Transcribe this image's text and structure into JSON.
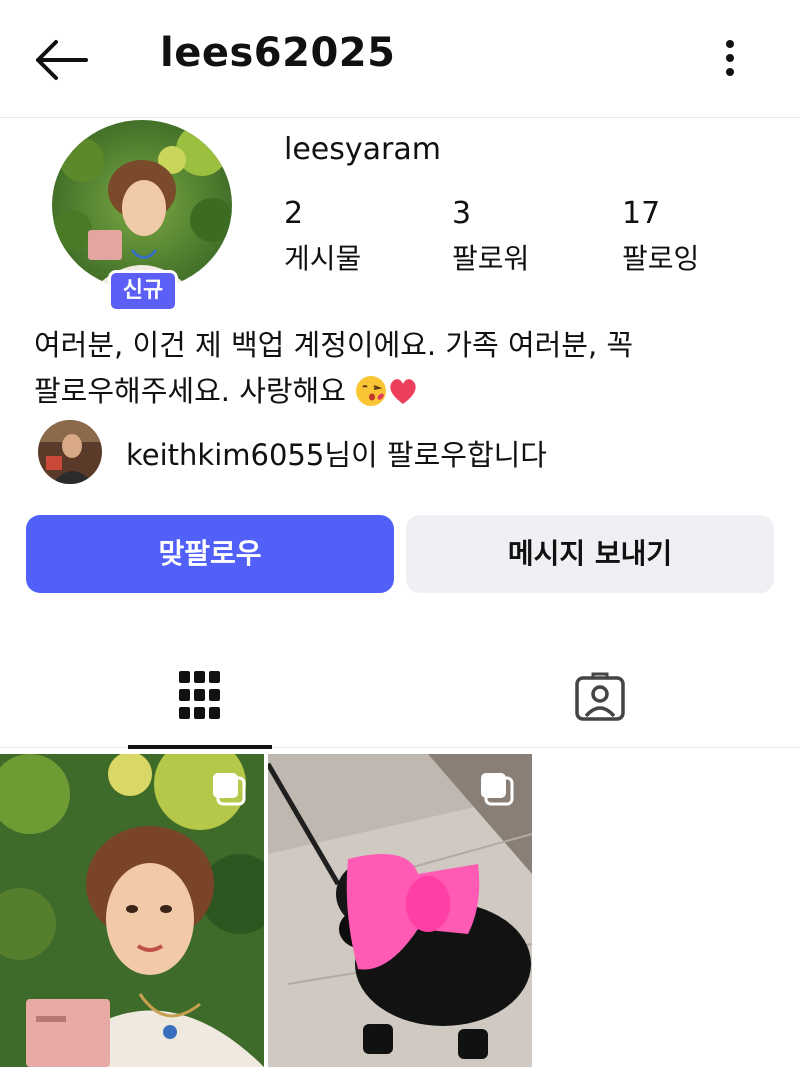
{
  "header": {
    "title": "lees62025"
  },
  "profile": {
    "username": "leesyaram",
    "badge": "신규",
    "stats": [
      {
        "count": "2",
        "label": "게시물"
      },
      {
        "count": "3",
        "label": "팔로워"
      },
      {
        "count": "17",
        "label": "팔로잉"
      }
    ],
    "bio_line1": "여러분, 이건 제 백업 계정이에요. 가족 여러분, 꼭",
    "bio_line2": "팔로우해주세요. 사랑해요"
  },
  "followed_by": {
    "user": "keithkim6055",
    "suffix": "님이 팔로우합니다"
  },
  "actions": {
    "follow_back": "맞팔로우",
    "message": "메시지 보내기"
  },
  "colors": {
    "accent": "#5160f8",
    "badge": "#5b5ff5",
    "secondary_button": "#eff0f3"
  },
  "icons": {
    "back": "arrow-left-icon",
    "more": "more-vertical-icon",
    "grid": "grid-icon",
    "tagged": "tagged-person-icon",
    "multi": "carousel-icon"
  }
}
